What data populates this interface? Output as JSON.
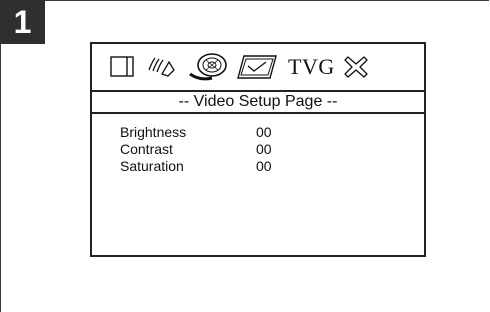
{
  "step": {
    "number": "1"
  },
  "osd": {
    "icons": [
      {
        "name": "general-setup-icon"
      },
      {
        "name": "audio-setup-icon"
      },
      {
        "name": "disc-video-setup-icon"
      },
      {
        "name": "display-check-icon"
      },
      {
        "name": "tvg-icon",
        "label": "TVG"
      },
      {
        "name": "exit-icon"
      }
    ],
    "page_title": "-- Video Setup Page --",
    "settings": [
      {
        "label": "Brightness",
        "value": "00"
      },
      {
        "label": "Contrast",
        "value": "00"
      },
      {
        "label": "Saturation",
        "value": "00"
      }
    ]
  }
}
